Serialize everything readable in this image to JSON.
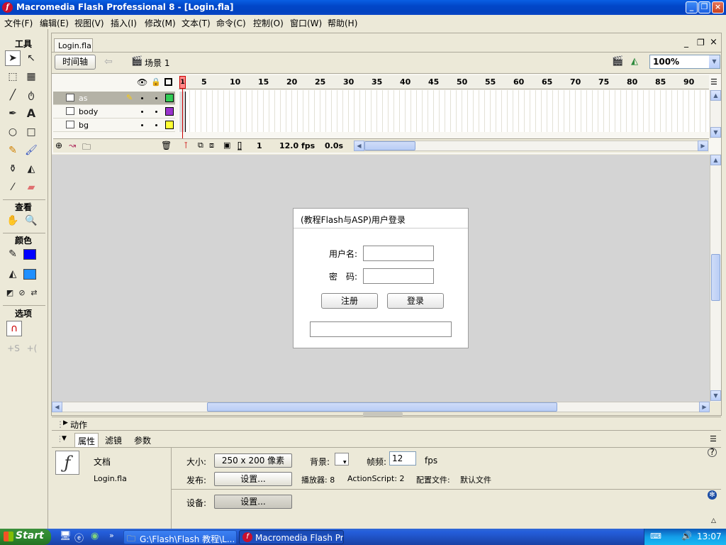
{
  "window": {
    "title": "Macromedia Flash Professional 8 - [Login.fla]",
    "minimize": "_",
    "restore": "❐",
    "close": "×"
  },
  "menu": [
    "文件(F)",
    "编辑(E)",
    "视图(V)",
    "插入(I)",
    "修改(M)",
    "文本(T)",
    "命令(C)",
    "控制(O)",
    "窗口(W)",
    "帮助(H)"
  ],
  "tools": {
    "header": "工具",
    "view_header": "查看",
    "colors_header": "颜色",
    "options_header": "选项",
    "stroke_color": "#0000ff",
    "fill_color": "#1f8fff"
  },
  "document": {
    "tab": "Login.fla",
    "timeline_button": "时间轴",
    "scene": "场景 1",
    "zoom": "100%"
  },
  "timeline": {
    "ruler_ticks": [
      "1",
      "5",
      "10",
      "15",
      "20",
      "25",
      "30",
      "35",
      "40",
      "45",
      "50",
      "55",
      "60",
      "65",
      "70",
      "75",
      "80",
      "85",
      "90"
    ],
    "layers": [
      {
        "name": "as",
        "color": "#33cc55",
        "selected": true
      },
      {
        "name": "body",
        "color": "#9933cc",
        "selected": false
      },
      {
        "name": "bg",
        "color": "#ffff33",
        "selected": false
      }
    ],
    "current_frame": "1",
    "frame_rate": "12.0 fps",
    "elapsed": "0.0s"
  },
  "stage": {
    "window_title": "(教程Flash与ASP)用户登录",
    "username_label": "用户名:",
    "password_label": "密　码:",
    "register_button": "注册",
    "login_button": "登录"
  },
  "panels": {
    "actions": "动作",
    "tabs": [
      "属性",
      "滤镜",
      "参数"
    ],
    "doc_type": "文档",
    "doc_name": "Login.fla",
    "size_label": "大小:",
    "size_value": "250 x 200 像素",
    "bg_label": "背景:",
    "fps_label": "帧频:",
    "fps_value": "12",
    "fps_unit": "fps",
    "publish_label": "发布:",
    "publish_button": "设置...",
    "player_info": "播放器: 8",
    "as_info": "ActionScript: 2",
    "profile_label": "配置文件:",
    "profile_value": "默认文件",
    "device_label": "设备:",
    "device_button": "设置..."
  },
  "taskbar": {
    "start": "Start",
    "task1": "G:\\Flash\\Flash 教程\\L...",
    "task2": "Macromedia Flash Prof...",
    "clock": "13:07"
  }
}
